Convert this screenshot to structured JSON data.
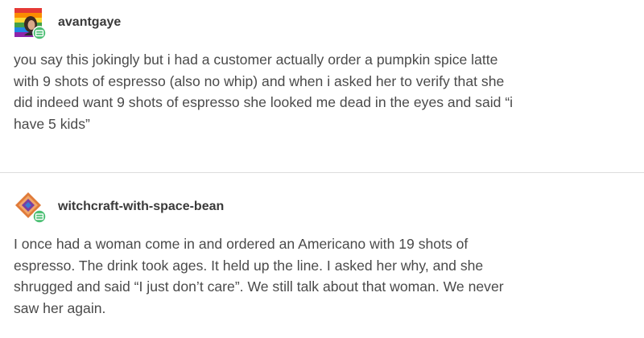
{
  "posts": [
    {
      "username": "avantgaye",
      "avatar_icon": "rainbow-avatar-icon",
      "lines": [
        "you say this jokingly but i had a customer actually order a pumpkin spice latte",
        "with 9 shots of espresso (also no whip) and when i asked her to verify that she",
        "did indeed want 9 shots of espresso she looked me dead in the eyes and said “i",
        "have 5 kids”"
      ]
    },
    {
      "username": "witchcraft-with-space-bean",
      "avatar_icon": "diamond-avatar-icon",
      "lines": [
        "I once had a woman come in and ordered an Americano with 19 shots of",
        "espresso. The drink took ages. It held up the line. I asked her why, and she",
        "shrugged and said “I just don’t care”. We still talk about that woman. We never",
        "saw her again."
      ]
    }
  ],
  "colors": {
    "text": "#4a4a4a",
    "username": "#3a3a3a",
    "badge": "#4bbf73",
    "divider": "#dcdcdc"
  },
  "icons": {
    "badge": "follow-badge-icon"
  }
}
